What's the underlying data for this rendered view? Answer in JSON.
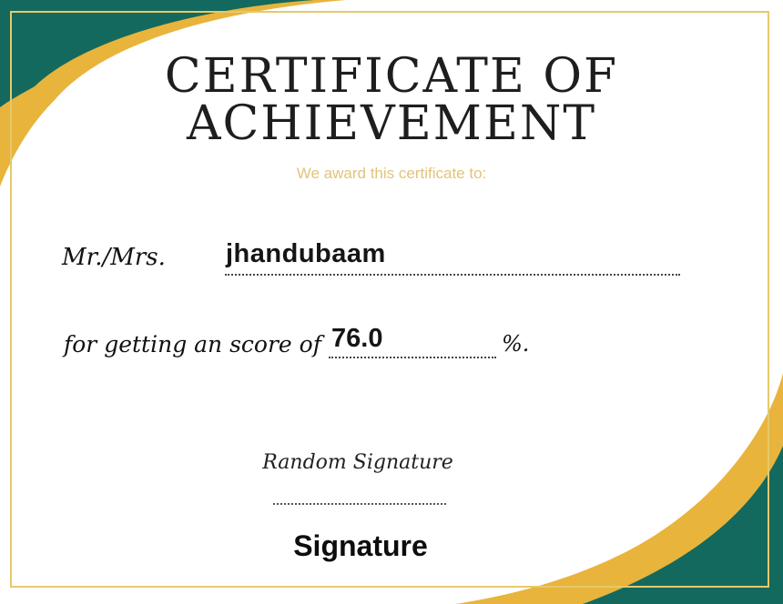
{
  "certificate": {
    "title_line1": "CERTIFICATE OF",
    "title_line2": "ACHIEVEMENT",
    "subtitle": "We award this certificate to:",
    "salutation": "Mr./Mrs.",
    "recipient_name": "jhandubaam",
    "score_prefix": "for getting an score of",
    "score_value": "76.0",
    "score_suffix": "%.",
    "signature_script": "Random Signature",
    "signature_label": "Signature"
  },
  "colors": {
    "teal": "#14695e",
    "gold": "#e8b43c",
    "frame": "#e6c96a"
  }
}
